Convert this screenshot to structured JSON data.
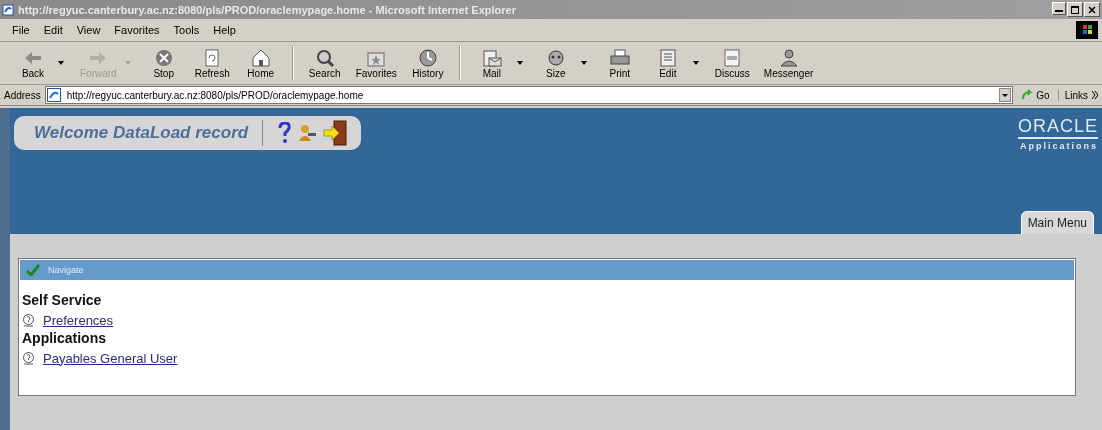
{
  "window": {
    "title": "http://regyuc.canterbury.ac.nz:8080/pls/PROD/oraclemypage.home - Microsoft Internet Explorer"
  },
  "menu": [
    "File",
    "Edit",
    "View",
    "Favorites",
    "Tools",
    "Help"
  ],
  "toolbar": [
    {
      "label": "Back",
      "disabled": false,
      "dropdown": true
    },
    {
      "label": "Forward",
      "disabled": true,
      "dropdown": true
    },
    {
      "label": "Stop",
      "disabled": false,
      "dropdown": false
    },
    {
      "label": "Refresh",
      "disabled": false,
      "dropdown": false
    },
    {
      "label": "Home",
      "disabled": false,
      "dropdown": false
    },
    {
      "label": "Search",
      "disabled": false,
      "dropdown": false
    },
    {
      "label": "Favorites",
      "disabled": false,
      "dropdown": false
    },
    {
      "label": "History",
      "disabled": false,
      "dropdown": false
    },
    {
      "label": "Mail",
      "disabled": false,
      "dropdown": true
    },
    {
      "label": "Size",
      "disabled": false,
      "dropdown": true
    },
    {
      "label": "Print",
      "disabled": false,
      "dropdown": false
    },
    {
      "label": "Edit",
      "disabled": false,
      "dropdown": true
    },
    {
      "label": "Discuss",
      "disabled": false,
      "dropdown": false
    },
    {
      "label": "Messenger",
      "disabled": false,
      "dropdown": false
    }
  ],
  "address_bar": {
    "label": "Address",
    "value": "http://regyuc.canterbury.ac.nz:8080/pls/PROD/oraclemypage.home",
    "go": "Go",
    "links": "Links"
  },
  "header": {
    "welcome": "Welcome DataLoad record",
    "logo": "ORACLE",
    "logo_subtitle": "Applications"
  },
  "tabs": [
    {
      "label": "Main Menu",
      "selected": true
    }
  ],
  "navigator": {
    "title": "Navigate",
    "sections": [
      {
        "heading": "Self Service",
        "links": [
          "Preferences"
        ]
      },
      {
        "heading": "Applications",
        "links": [
          "Payables General User"
        ]
      }
    ]
  }
}
